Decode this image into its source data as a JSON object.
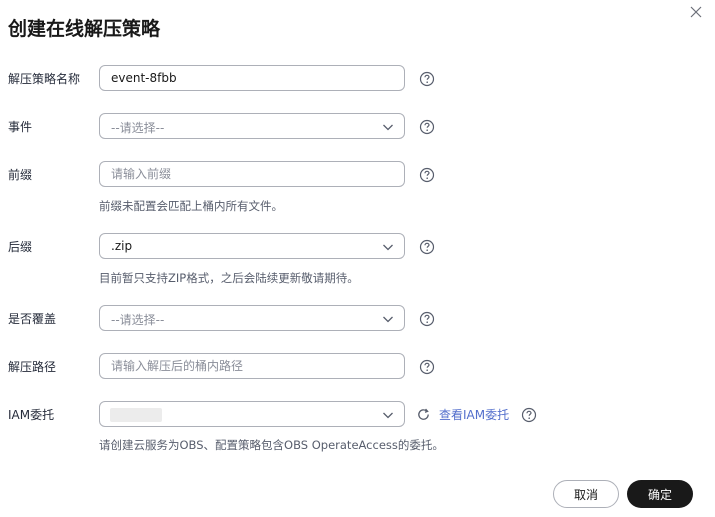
{
  "dialog": {
    "title": "创建在线解压策略",
    "cancel_label": "取消",
    "confirm_label": "确定"
  },
  "fields": {
    "policy_name": {
      "label": "解压策略名称",
      "value": "event-8fbb"
    },
    "event": {
      "label": "事件",
      "placeholder": "--请选择--"
    },
    "prefix": {
      "label": "前缀",
      "placeholder": "请输入前缀",
      "hint": "前缀未配置会匹配上桶内所有文件。"
    },
    "suffix": {
      "label": "后缀",
      "value": ".zip",
      "hint": "目前暂只支持ZIP格式，之后会陆续更新敬请期待。"
    },
    "overwrite": {
      "label": "是否覆盖",
      "placeholder": "--请选择--"
    },
    "decompress_path": {
      "label": "解压路径",
      "placeholder": "请输入解压后的桶内路径"
    },
    "iam_agency": {
      "label": "IAM委托",
      "view_link": "查看IAM委托",
      "hint": "请创建云服务为OBS、配置策略包含OBS OperateAccess的委托。"
    }
  },
  "icons": {
    "close": "close-icon",
    "help": "question-circle-icon",
    "chevron": "chevron-down-icon",
    "refresh": "refresh-icon"
  },
  "colors": {
    "primary_button": "#191919",
    "link": "#526ecc",
    "border": "#adb0b8",
    "placeholder": "#8a8e99",
    "hint": "#575d6c"
  }
}
